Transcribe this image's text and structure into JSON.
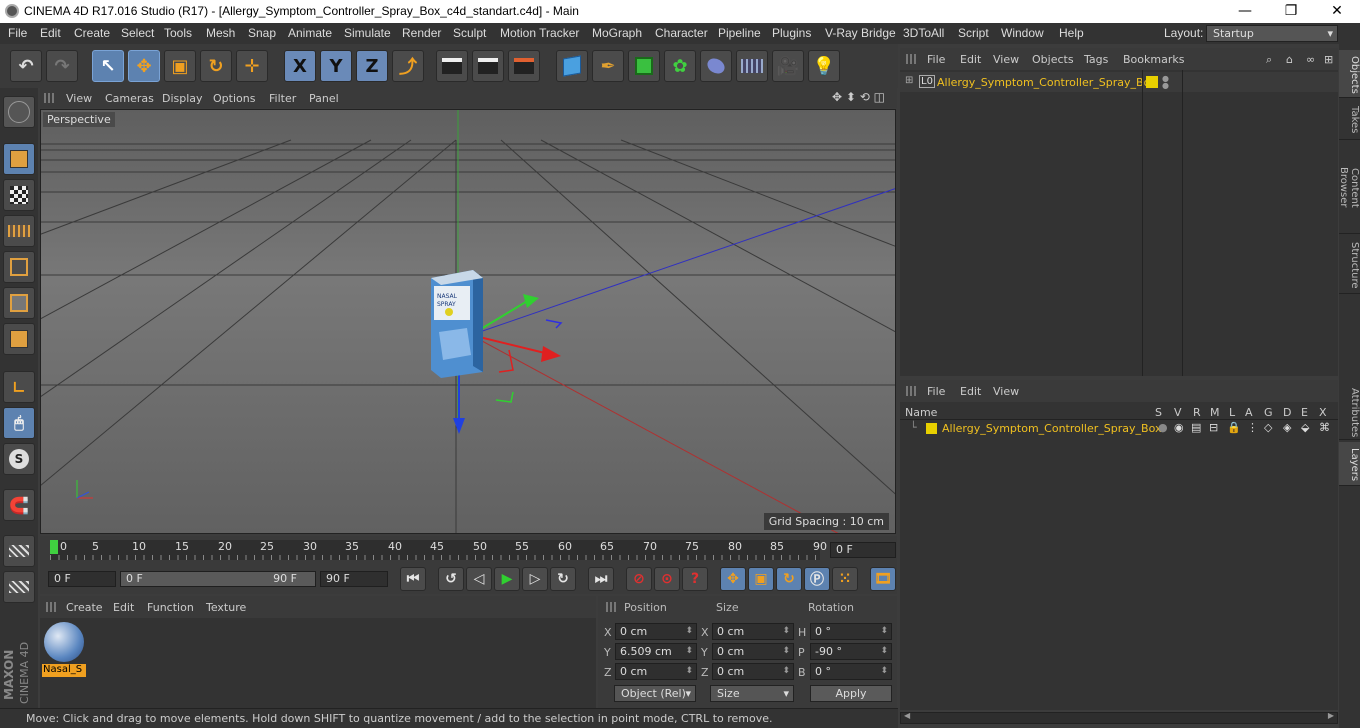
{
  "window": {
    "title": "CINEMA 4D R17.016 Studio (R17) - [Allergy_Symptom_Controller_Spray_Box_c4d_standart.c4d] - Main",
    "minimize": "—",
    "maximize": "❐",
    "close": "✕"
  },
  "menubar": {
    "items": [
      "File",
      "Edit",
      "Create",
      "Select",
      "Tools",
      "Mesh",
      "Snap",
      "Animate",
      "Simulate",
      "Render",
      "Sculpt",
      "Motion Tracker",
      "MoGraph",
      "Character",
      "Pipeline",
      "Plugins",
      "V-Ray Bridge",
      "3DToAll",
      "Script",
      "Window",
      "Help"
    ],
    "layout_label": "Layout:",
    "layout_value": "Startup"
  },
  "toolbar": {
    "undo": "↶",
    "redo": "↷",
    "select": "↖",
    "move": "✥",
    "scale": "▣",
    "rotate": "↻",
    "transform": "✛",
    "x": "X",
    "y": "Y",
    "z": "Z",
    "coord": "⤴"
  },
  "viewport": {
    "menu": [
      "View",
      "Cameras",
      "Display",
      "Options",
      "Filter",
      "Panel"
    ],
    "label": "Perspective",
    "grid_spacing": "Grid Spacing : 10 cm",
    "box_text_1": "NASAL",
    "box_text_2": "SPRAY"
  },
  "timeline": {
    "ticks": [
      "0",
      "5",
      "10",
      "15",
      "20",
      "25",
      "30",
      "35",
      "40",
      "45",
      "50",
      "55",
      "60",
      "65",
      "70",
      "75",
      "80",
      "85",
      "90"
    ],
    "end_frame": "0 F",
    "start": "0 F",
    "range_start": "0 F",
    "range_end": "90 F",
    "max": "90 F"
  },
  "material": {
    "menu": [
      "Create",
      "Edit",
      "Function",
      "Texture"
    ],
    "name": "Nasal_S"
  },
  "coords": {
    "headers": [
      "Position",
      "Size",
      "Rotation"
    ],
    "rows": [
      {
        "axis": "X",
        "pos": "0 cm",
        "saxis": "X",
        "size": "0 cm",
        "raxis": "H",
        "rot": "0 °"
      },
      {
        "axis": "Y",
        "pos": "6.509 cm",
        "saxis": "Y",
        "size": "0 cm",
        "raxis": "P",
        "rot": "-90 °"
      },
      {
        "axis": "Z",
        "pos": "0 cm",
        "saxis": "Z",
        "size": "0 cm",
        "raxis": "B",
        "rot": "0 °"
      }
    ],
    "mode": "Object (Rel)",
    "size_mode": "Size",
    "apply": "Apply"
  },
  "status": "Move: Click and drag to move elements. Hold down SHIFT to quantize movement / add to the selection in point mode, CTRL to remove.",
  "objects": {
    "menu": [
      "File",
      "Edit",
      "View",
      "Objects",
      "Tags",
      "Bookmarks"
    ],
    "item": "Allergy_Symptom_Controller_Spray_Box"
  },
  "layers": {
    "menu": [
      "File",
      "Edit",
      "View"
    ],
    "name_header": "Name",
    "columns": [
      "S",
      "V",
      "R",
      "M",
      "L",
      "A",
      "G",
      "D",
      "E",
      "X"
    ],
    "item": "Allergy_Symptom_Controller_Spray_Box"
  },
  "right_tabs": [
    "Objects",
    "Takes",
    "Content Browser",
    "Structure",
    "Attributes",
    "Layers"
  ],
  "brand": {
    "maxon": "MAXON",
    "cinema": "CINEMA 4D"
  },
  "colors": {
    "accent": "#5d82b0",
    "selected_text": "#f0c020",
    "layer_color": "#e8d000"
  }
}
